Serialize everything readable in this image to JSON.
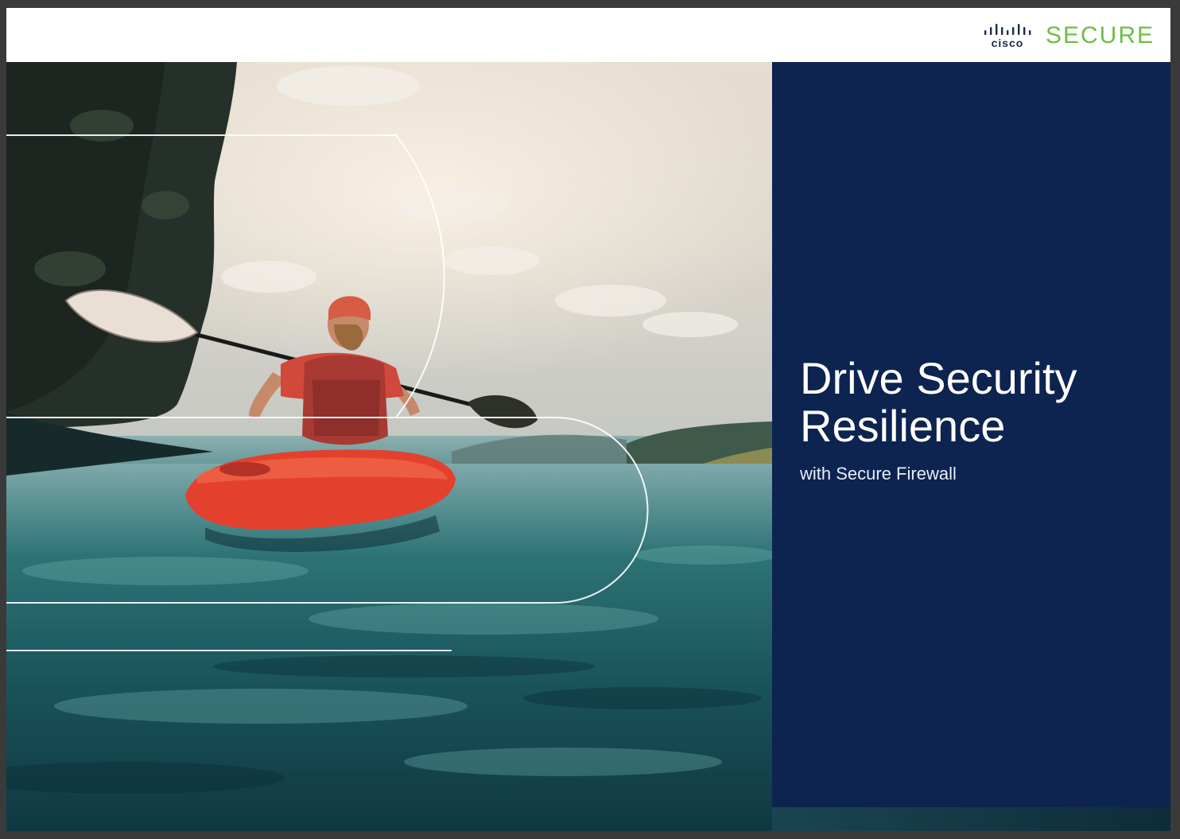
{
  "header": {
    "brand_cisco": "cisco",
    "brand_secure": "SECURE"
  },
  "hero": {
    "title_line1": "Drive Security",
    "title_line2": "Resilience",
    "subtitle": "with Secure Firewall"
  },
  "colors": {
    "panel_navy": "#0d2350",
    "secure_green": "#6cbe45",
    "cisco_navy": "#1a2b4a"
  },
  "icons": [
    "cisco-bridge-icon"
  ]
}
